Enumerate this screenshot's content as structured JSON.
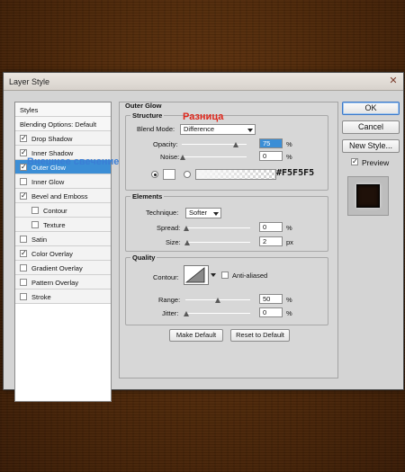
{
  "window": {
    "title": "Layer Style",
    "close_glyph": "✕"
  },
  "styles_list": {
    "items": [
      {
        "label": "Styles",
        "type": "header",
        "checked": false
      },
      {
        "label": "Blending Options: Default",
        "type": "header",
        "checked": false
      },
      {
        "label": "Drop Shadow",
        "type": "check",
        "checked": true
      },
      {
        "label": "Inner Shadow",
        "type": "check",
        "checked": true
      },
      {
        "label": "Outer Glow",
        "type": "check",
        "checked": true,
        "selected": true
      },
      {
        "label": "Inner Glow",
        "type": "check",
        "checked": false
      },
      {
        "label": "Bevel and Emboss",
        "type": "check",
        "checked": true
      },
      {
        "label": "Contour",
        "type": "sub",
        "checked": false
      },
      {
        "label": "Texture",
        "type": "sub",
        "checked": false
      },
      {
        "label": "Satin",
        "type": "check",
        "checked": false
      },
      {
        "label": "Color Overlay",
        "type": "check",
        "checked": true
      },
      {
        "label": "Gradient Overlay",
        "type": "check",
        "checked": false
      },
      {
        "label": "Pattern Overlay",
        "type": "check",
        "checked": false
      },
      {
        "label": "Stroke",
        "type": "check",
        "checked": false
      }
    ]
  },
  "outer_glow": {
    "section_title": "Outer Glow",
    "structure": {
      "title": "Structure",
      "blend_mode_label": "Blend Mode:",
      "blend_mode_value": "Difference",
      "opacity_label": "Opacity:",
      "opacity_value": "75",
      "opacity_unit": "%",
      "noise_label": "Noise:",
      "noise_value": "0",
      "noise_unit": "%",
      "color_hex": "#F5F5F5"
    },
    "elements": {
      "title": "Elements",
      "technique_label": "Technique:",
      "technique_value": "Softer",
      "spread_label": "Spread:",
      "spread_value": "0",
      "spread_unit": "%",
      "size_label": "Size:",
      "size_value": "2",
      "size_unit": "px"
    },
    "quality": {
      "title": "Quality",
      "contour_label": "Contour:",
      "anti_aliased_label": "Anti-aliased",
      "range_label": "Range:",
      "range_value": "50",
      "range_unit": "%",
      "jitter_label": "Jitter:",
      "jitter_value": "0",
      "jitter_unit": "%"
    },
    "make_default_label": "Make Default",
    "reset_default_label": "Reset to Default"
  },
  "right_buttons": {
    "ok_label": "OK",
    "cancel_label": "Cancel",
    "new_style_label": "New Style...",
    "preview_label": "Preview"
  },
  "annotations": {
    "blend_note_ru": "Разница",
    "outer_glow_note_ru": "Внешнее свечение"
  },
  "colors": {
    "glow_color": "#F5F5F5",
    "selection_blue": "#3b8ed6",
    "annotation_red": "#e0261b",
    "annotation_blue": "#3b7ed6",
    "background_wood": "#4c2709"
  }
}
